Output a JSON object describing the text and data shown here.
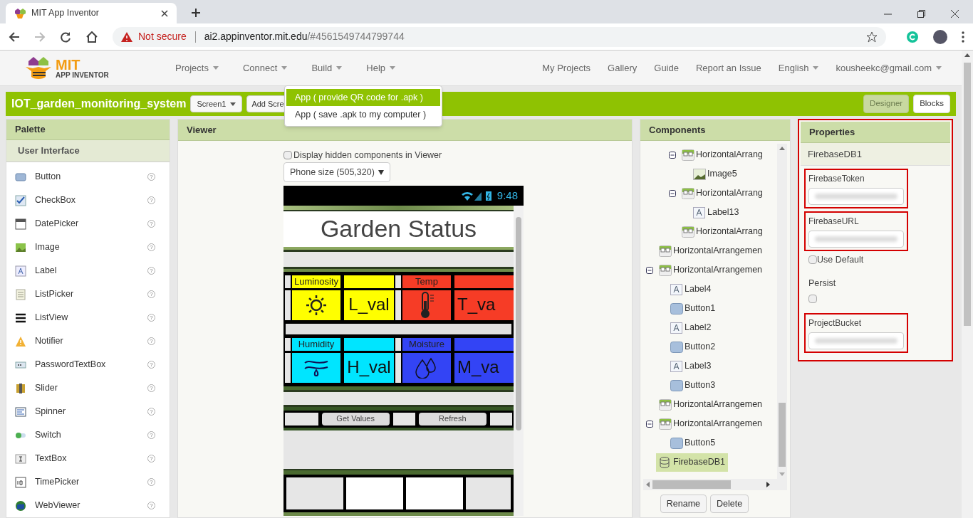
{
  "browser": {
    "tab_title": "MIT App Inventor",
    "security": "Not secure",
    "url_host": "ai2.appinventor.mit.edu",
    "url_path": "/#4561549744799744"
  },
  "header": {
    "logo_top": "MIT",
    "logo_bottom": "APP INVENTOR",
    "menus": [
      "Projects",
      "Connect",
      "Build",
      "Help"
    ],
    "links": [
      "My Projects",
      "Gallery",
      "Guide",
      "Report an Issue"
    ],
    "language": "English",
    "account": "kousheekc@gmail.com"
  },
  "project": {
    "name": "IOT_garden_monitoring_system",
    "screen": "Screen1",
    "add_screen": "Add Scre",
    "modes": [
      {
        "label": "Designer",
        "selected": true
      },
      {
        "label": "Blocks",
        "selected": false
      }
    ]
  },
  "build_menu": [
    {
      "label": "App ( provide QR code for .apk )",
      "selected": true
    },
    {
      "label": "App ( save .apk to my computer )",
      "selected": false
    }
  ],
  "palette": {
    "title": "Palette",
    "section": "User Interface",
    "items": [
      "Button",
      "CheckBox",
      "DatePicker",
      "Image",
      "Label",
      "ListPicker",
      "ListView",
      "Notifier",
      "PasswordTextBox",
      "Slider",
      "Spinner",
      "Switch",
      "TextBox",
      "TimePicker",
      "WebViewer"
    ],
    "help": "?"
  },
  "viewer": {
    "title": "Viewer",
    "hidden_checkbox": {
      "label": "Display hidden components in Viewer",
      "checked": false
    },
    "phone_size": "Phone size (505,320)",
    "phone": {
      "time": "9:48",
      "title": "Garden Status",
      "sensors": [
        {
          "label": "Luminosity",
          "value": "L_val",
          "color": "#ffff00"
        },
        {
          "label": "Temp",
          "value": "T_va",
          "color": "#f63c26"
        },
        {
          "label": "Humidity",
          "value": "H_val",
          "color": "#00e5ff"
        },
        {
          "label": "Moisture",
          "value": "M_va",
          "color": "#3344f5"
        }
      ],
      "buttons": [
        "Get Values",
        "Refresh"
      ]
    }
  },
  "components": {
    "title": "Components",
    "continued": [
      {
        "label": "HorizontalArrang",
        "kind": "arrangement",
        "expanded": true,
        "selected": false,
        "children": [
          {
            "label": "Image5",
            "kind": "image",
            "selected": false
          }
        ]
      },
      {
        "label": "HorizontalArrang",
        "kind": "arrangement",
        "expanded": true,
        "selected": false,
        "children": [
          {
            "label": "Label13",
            "kind": "label",
            "selected": false
          }
        ]
      },
      {
        "label": "HorizontalArrang",
        "kind": "arrangement",
        "selected": false
      }
    ],
    "tree": [
      {
        "label": "HorizontalArrangemen",
        "kind": "arrangement",
        "selected": false
      },
      {
        "label": "HorizontalArrangemen",
        "kind": "arrangement",
        "expanded": true,
        "selected": false,
        "children": [
          {
            "label": "Label4",
            "kind": "label",
            "selected": false
          },
          {
            "label": "Button1",
            "kind": "button",
            "selected": false
          },
          {
            "label": "Label2",
            "kind": "label",
            "selected": false
          },
          {
            "label": "Button2",
            "kind": "button",
            "selected": false
          },
          {
            "label": "Label3",
            "kind": "label",
            "selected": false
          },
          {
            "label": "Button3",
            "kind": "button",
            "selected": false
          }
        ]
      },
      {
        "label": "HorizontalArrangemen",
        "kind": "arrangement",
        "selected": false
      },
      {
        "label": "HorizontalArrangemen",
        "kind": "arrangement",
        "expanded": true,
        "selected": false,
        "children": [
          {
            "label": "Button5",
            "kind": "button",
            "selected": false
          }
        ]
      },
      {
        "label": "FirebaseDB1",
        "kind": "database",
        "selected": true
      }
    ],
    "buttons": [
      "Rename",
      "Delete"
    ]
  },
  "properties": {
    "title": "Properties",
    "component": "FirebaseDB1",
    "items": [
      {
        "kind": "field",
        "label": "FirebaseToken"
      },
      {
        "kind": "field",
        "label": "FirebaseURL"
      },
      {
        "kind": "inline_checkbox",
        "label": "Use Default",
        "checked": false
      },
      {
        "kind": "checkbox",
        "label": "Persist",
        "checked": false
      },
      {
        "kind": "field",
        "label": "ProjectBucket"
      }
    ]
  }
}
